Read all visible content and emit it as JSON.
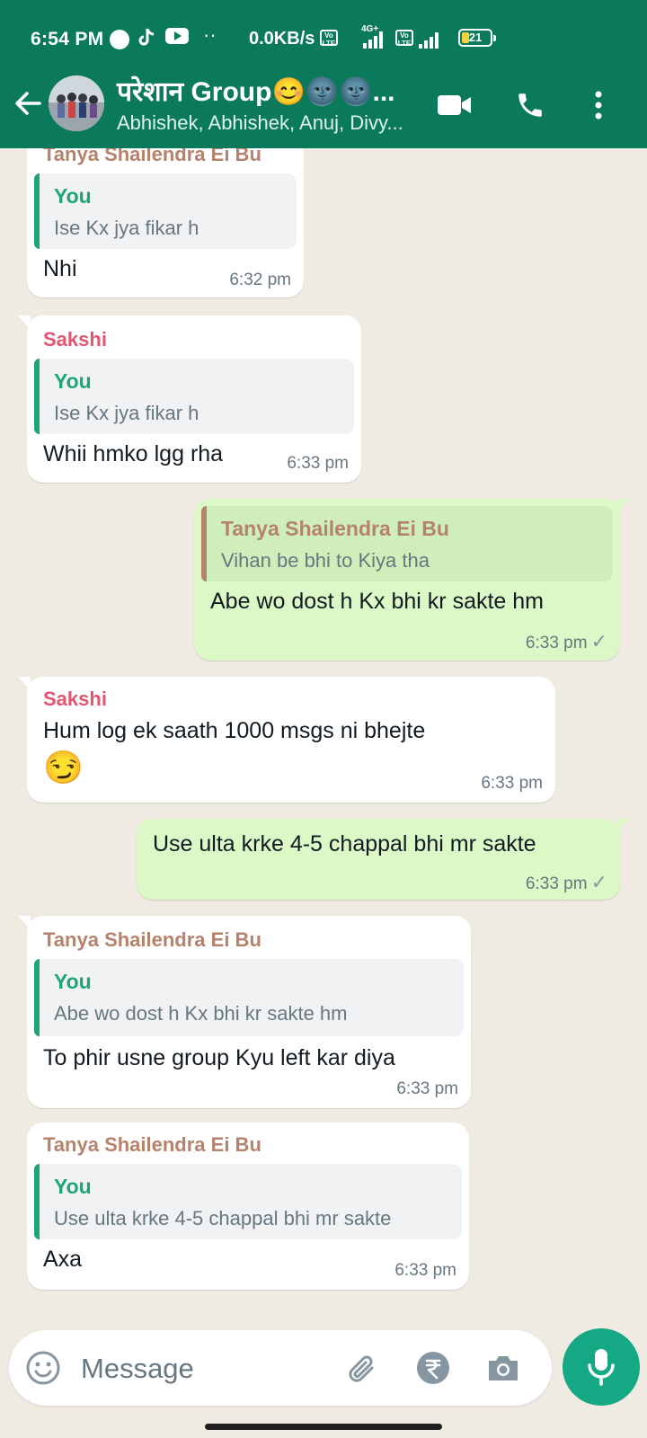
{
  "status_bar": {
    "time": "6:54 PM",
    "speed": "0.0KB/s",
    "volte_1": "Vo LTE",
    "network_1": "4G+",
    "volte_2": "Vo LTE",
    "battery": "21",
    "battery_fraction": 0.21,
    "icons": [
      "record-dot-icon",
      "tiktok-icon",
      "youtube-icon",
      "more-dots-icon",
      "signal-icon",
      "battery-icon"
    ]
  },
  "header": {
    "title": "परेशान Group😊🌚🌚...",
    "subtitle": "Abhishek, Abhishek, Anuj, Divy...",
    "colors": {
      "header_bg": "#0b7a5b"
    }
  },
  "colors": {
    "chat_bg": "#efeae2",
    "incoming_bubble": "#ffffff",
    "outgoing_bubble": "#dbf8c6",
    "sender_tanya": "#b5826c",
    "sender_sakshi": "#e05570",
    "quote_you": "#1fa47a",
    "mic_button": "#15a884"
  },
  "messages": [
    {
      "sender": "Tanya Shailendra Ei Bu",
      "quote_name": "You",
      "quote_text": "Ise Kx jya fikar h",
      "text": "Nhi",
      "time": "6:32 pm"
    },
    {
      "sender": "Sakshi",
      "quote_name": "You",
      "quote_text": "Ise Kx jya fikar h",
      "text": "Whii hmko lgg rha",
      "time": "6:33 pm"
    },
    {
      "quote_name": "Tanya Shailendra Ei Bu",
      "quote_text": "Vihan be bhi to Kiya tha",
      "text": "Abe wo dost h Kx bhi kr sakte hm",
      "time": "6:33 pm",
      "tick": "✓"
    },
    {
      "sender": "Sakshi",
      "text": "Hum log ek saath 1000 msgs ni bhejte",
      "emoji": "😏",
      "time": "6:33 pm"
    },
    {
      "text": "Use ulta krke 4-5 chappal bhi mr sakte",
      "time": "6:33 pm",
      "tick": "✓"
    },
    {
      "sender": "Tanya Shailendra Ei Bu",
      "quote_name": "You",
      "quote_text": "Abe wo dost h Kx bhi kr sakte hm",
      "text": "To phir usne group Kyu left kar diya",
      "time": "6:33 pm"
    },
    {
      "sender": "Tanya Shailendra Ei Bu",
      "quote_name": "You",
      "quote_text": "Use ulta krke 4-5 chappal bhi mr sakte",
      "text": "Axa",
      "time": "6:33 pm"
    }
  ],
  "input": {
    "placeholder": "Message"
  }
}
